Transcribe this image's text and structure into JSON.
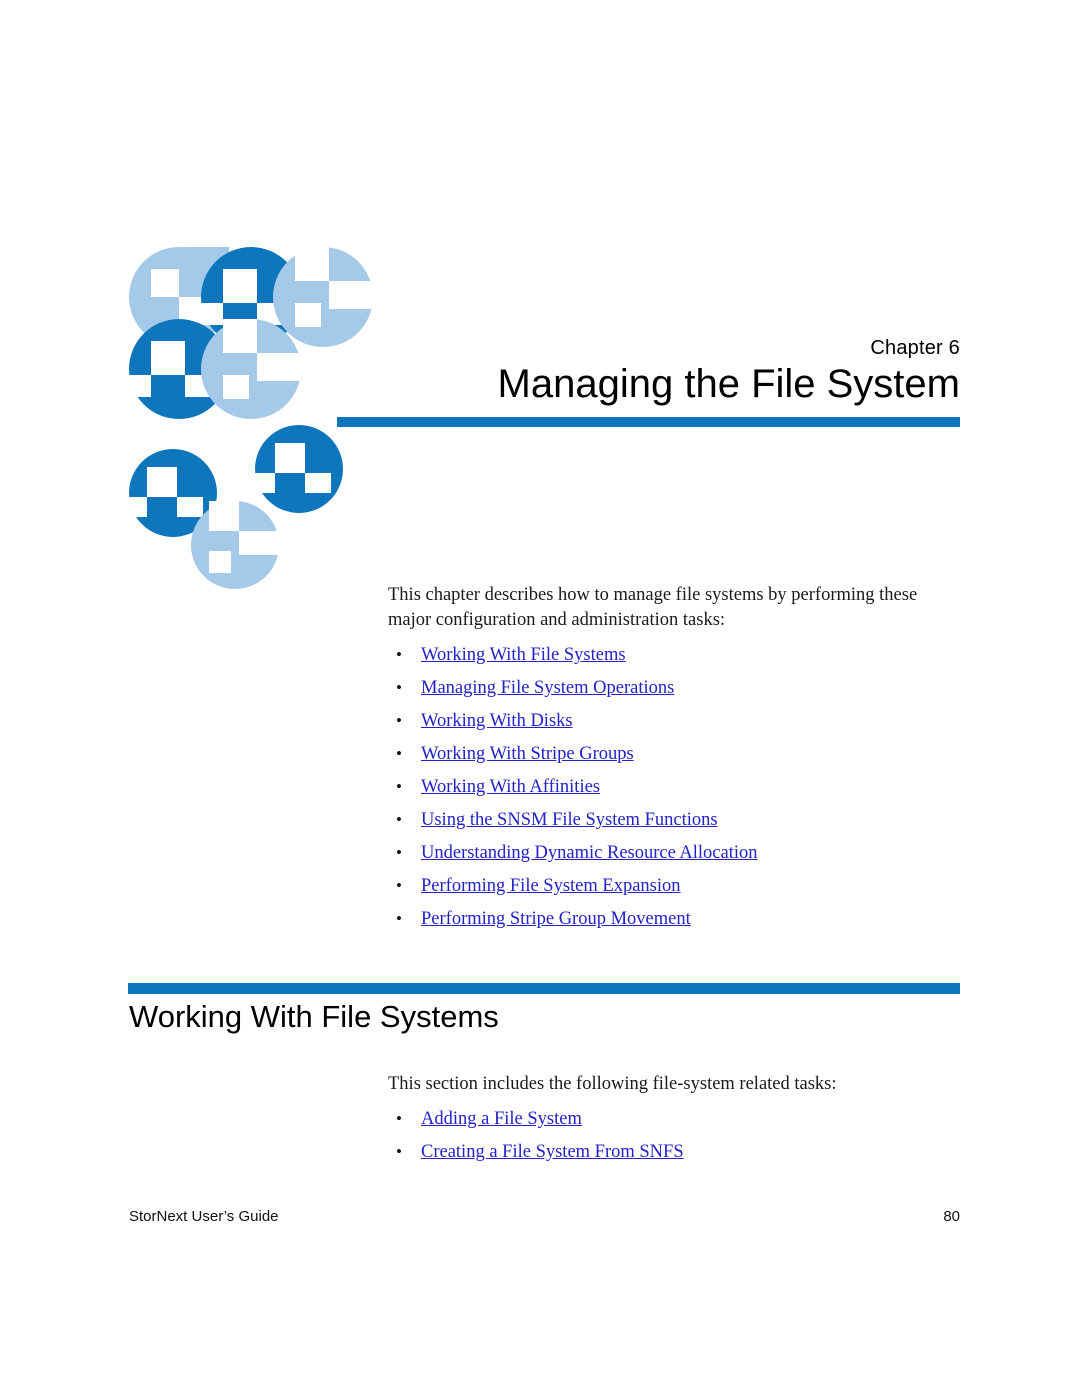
{
  "document": {
    "chapter_label": "Chapter  6",
    "chapter_title": "Managing the File System",
    "logo_name": "quantum-logo"
  },
  "intro": {
    "paragraph": "This chapter describes how to manage file systems by performing these major configuration and administration tasks:",
    "links": [
      "Working With File Systems",
      "Managing File System Operations",
      "Working With Disks",
      "Working With Stripe Groups",
      "Working With Affinities",
      "Using the SNSM File System Functions",
      "Understanding Dynamic Resource Allocation",
      "Performing File System Expansion",
      "Performing Stripe Group Movement"
    ]
  },
  "section": {
    "title": "Working With File Systems",
    "paragraph": "This section includes the following file-system related tasks:",
    "links": [
      "Adding a File System",
      "Creating a File System From SNFS"
    ]
  },
  "footer": {
    "guide_name": "StorNext User’s Guide",
    "page_number": "80"
  },
  "bullet_glyph": "•",
  "colors": {
    "accent_blue": "#0E76BC",
    "logo_light_blue": "#A5C9E9",
    "link_blue": "#2222C8",
    "text_black": "#000000"
  }
}
